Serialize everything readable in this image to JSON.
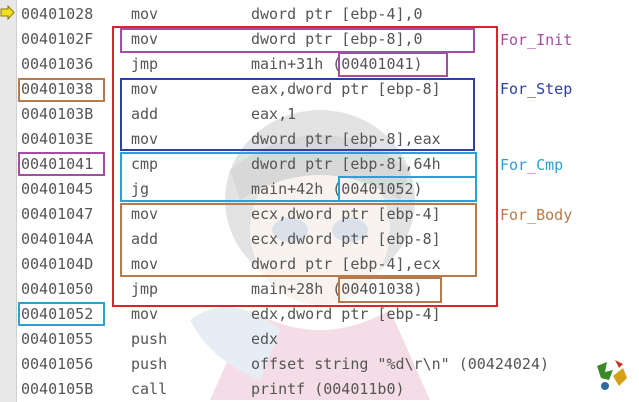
{
  "rows": [
    {
      "addr": "00401028",
      "mnem": "mov",
      "ops": "dword ptr [ebp-4],0"
    },
    {
      "addr": "0040102F",
      "mnem": "mov",
      "ops": "dword ptr [ebp-8],0"
    },
    {
      "addr": "00401036",
      "mnem": "jmp",
      "ops": "main+31h (00401041)"
    },
    {
      "addr": "00401038",
      "mnem": "mov",
      "ops": "eax,dword ptr [ebp-8]"
    },
    {
      "addr": "0040103B",
      "mnem": "add",
      "ops": "eax,1"
    },
    {
      "addr": "0040103E",
      "mnem": "mov",
      "ops": "dword ptr [ebp-8],eax"
    },
    {
      "addr": "00401041",
      "mnem": "cmp",
      "ops": "dword ptr [ebp-8],64h"
    },
    {
      "addr": "00401045",
      "mnem": "jg",
      "ops": "main+42h (00401052)"
    },
    {
      "addr": "00401047",
      "mnem": "mov",
      "ops": "ecx,dword ptr [ebp-4]"
    },
    {
      "addr": "0040104A",
      "mnem": "add",
      "ops": "ecx,dword ptr [ebp-8]"
    },
    {
      "addr": "0040104D",
      "mnem": "mov",
      "ops": "dword ptr [ebp-4],ecx"
    },
    {
      "addr": "00401050",
      "mnem": "jmp",
      "ops": "main+28h (00401038)"
    },
    {
      "addr": "00401052",
      "mnem": "mov",
      "ops": "edx,dword ptr [ebp-4]"
    },
    {
      "addr": "00401055",
      "mnem": "push",
      "ops": "edx"
    },
    {
      "addr": "00401056",
      "mnem": "push",
      "ops": "offset string \"%d\\r\\n\" (00424024)"
    },
    {
      "addr": "0040105B",
      "mnem": "call",
      "ops": "printf (004011b0)"
    }
  ],
  "labels": {
    "for_init": "For_Init",
    "for_step": "For_Step",
    "for_cmp": "For_Cmp",
    "for_body": "For_Body"
  },
  "colors": {
    "for_loop": "#d9242f",
    "for_init": "#a64ca6",
    "for_step": "#2f3fa8",
    "for_cmp": "#2aa3d4",
    "for_body": "#b87a4b",
    "current_line_arrow": "#f0e020",
    "text": "#555555"
  },
  "icons": {
    "current_line": "current-line-arrow-icon",
    "watermark": "anime-character-watermark",
    "logo": "corner-logo-icon"
  }
}
